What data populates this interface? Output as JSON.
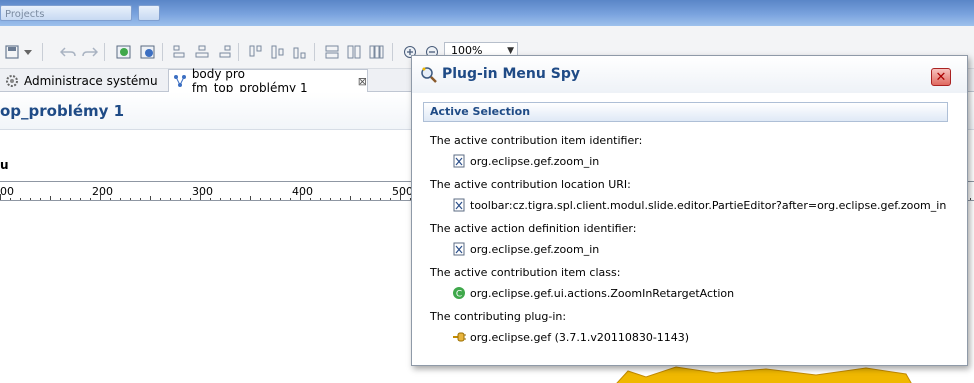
{
  "window": {
    "title_tab_text": "Projects"
  },
  "toolbar": {
    "zoom_value": "100%"
  },
  "tabs": [
    {
      "label": "Administrace systému",
      "active": false
    },
    {
      "label": "body pro fm_top_problémy 1",
      "active": true
    }
  ],
  "editor": {
    "title": "op_problémy 1",
    "column_label": "u",
    "ruler_numbers": [
      "00",
      "200",
      "300",
      "400",
      "500"
    ]
  },
  "spy": {
    "title": "Plug-in Menu Spy",
    "section_title": "Active Selection",
    "rows": [
      {
        "label": "The active contribution item identifier:",
        "value": "org.eclipse.gef.zoom_in",
        "icon": "x-doc-icon"
      },
      {
        "label": "The active contribution location URI:",
        "value": "toolbar:cz.tigra.spl.client.modul.slide.editor.PartieEditor?after=org.eclipse.gef.zoom_in",
        "icon": "x-doc-icon"
      },
      {
        "label": "The active action definition identifier:",
        "value": "org.eclipse.gef.zoom_in",
        "icon": "x-doc-icon"
      },
      {
        "label": "The active contribution item class:",
        "value": "org.eclipse.gef.ui.actions.ZoomInRetargetAction",
        "icon": "class-icon"
      },
      {
        "label": "The contributing plug-in:",
        "value": "org.eclipse.gef (3.7.1.v20110830-1143)",
        "icon": "plugin-icon"
      }
    ]
  },
  "colors": {
    "accent": "#1f4b86",
    "close_button": "#e06a60",
    "yellow_shape": "#f0b800"
  }
}
